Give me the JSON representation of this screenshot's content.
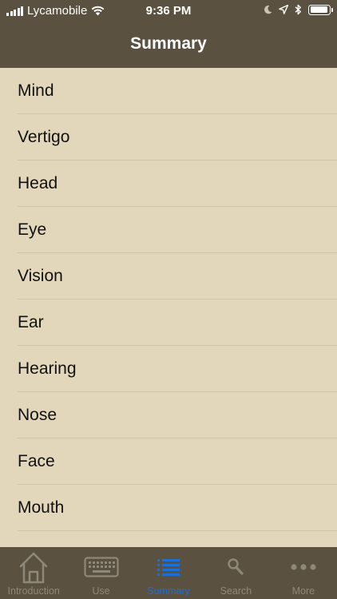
{
  "status_bar": {
    "carrier": "Lycamobile",
    "time": "9:36 PM"
  },
  "nav": {
    "title": "Summary"
  },
  "list": {
    "items": [
      "Mind",
      "Vertigo",
      "Head",
      "Eye",
      "Vision",
      "Ear",
      "Hearing",
      "Nose",
      "Face",
      "Mouth"
    ]
  },
  "tabbar": {
    "tabs": [
      {
        "label": "Introduction",
        "icon": "house-icon"
      },
      {
        "label": "Use",
        "icon": "keyboard-icon"
      },
      {
        "label": "Summary",
        "icon": "list-icon"
      },
      {
        "label": "Search",
        "icon": "search-icon"
      },
      {
        "label": "More",
        "icon": "more-icon"
      }
    ],
    "active": "Summary"
  },
  "colors": {
    "bar_background": "#5a5140",
    "list_background": "#e2d7bb",
    "active_tab": "#1a6fd9",
    "inactive_tab": "#8e887a"
  }
}
